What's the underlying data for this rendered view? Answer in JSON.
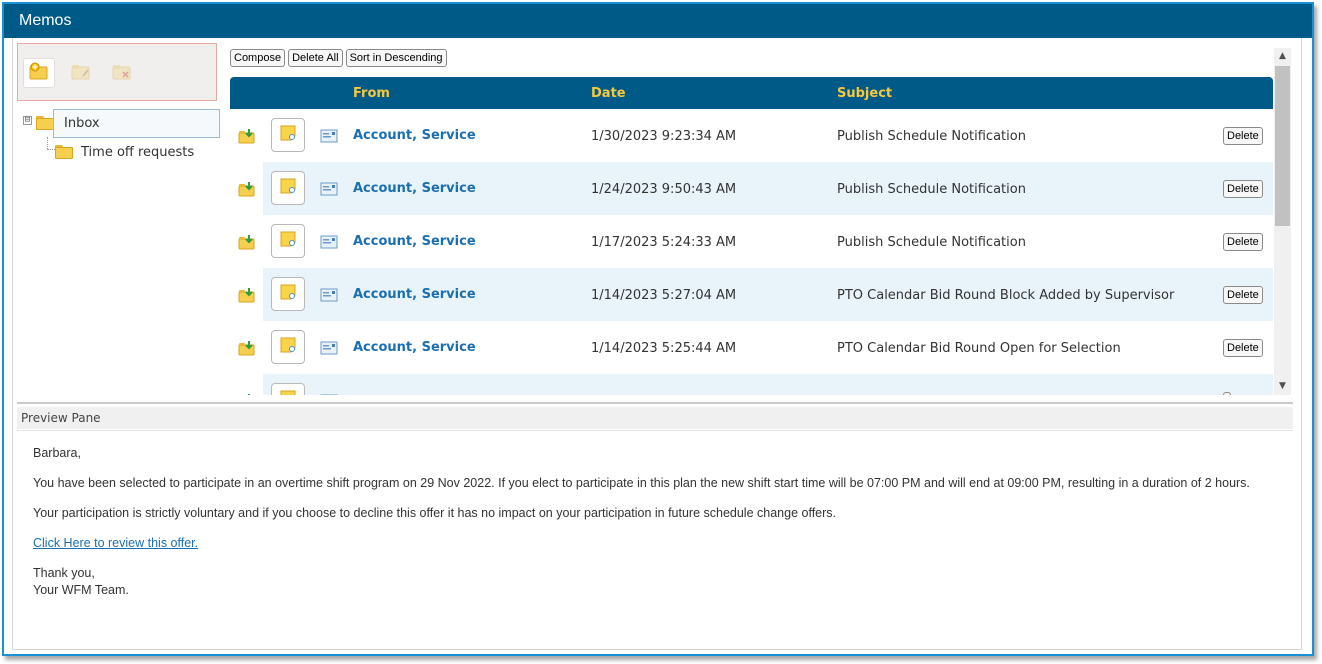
{
  "window": {
    "title": "Memos"
  },
  "folder_toolbar": {
    "buttons": [
      {
        "icon": "new-folder-icon",
        "state": "active"
      },
      {
        "icon": "edit-folder-icon",
        "state": "disabled"
      },
      {
        "icon": "delete-folder-icon",
        "state": "disabled"
      }
    ]
  },
  "tree": {
    "expander": "⊟",
    "inbox": "Inbox",
    "children": [
      "Time off requests"
    ]
  },
  "actions": {
    "compose": "Compose",
    "delete_all": "Delete All",
    "sort": "Sort in Descending"
  },
  "grid": {
    "columns": {
      "from": "From",
      "date": "Date",
      "subject": "Subject"
    },
    "delete_label": "Delete",
    "rows": [
      {
        "from": "Account, Service",
        "date": "1/30/2023 9:23:34 AM",
        "subject": "Publish Schedule Notification"
      },
      {
        "from": "Account, Service",
        "date": "1/24/2023 9:50:43 AM",
        "subject": "Publish Schedule Notification"
      },
      {
        "from": "Account, Service",
        "date": "1/17/2023 5:24:33 AM",
        "subject": "Publish Schedule Notification"
      },
      {
        "from": "Account, Service",
        "date": "1/14/2023 5:27:04 AM",
        "subject": "PTO Calendar Bid Round Block Added by Supervisor"
      },
      {
        "from": "Account, Service",
        "date": "1/14/2023 5:25:44 AM",
        "subject": "PTO Calendar Bid Round Open for Selection"
      }
    ]
  },
  "preview": {
    "header": "Preview Pane",
    "greeting": "Barbara,",
    "paragraph1": "You have been selected to participate in an overtime shift program on 29 Nov 2022.  If you elect to participate in this plan the new shift start time will be 07:00 PM and will end at 09:00 PM, resulting in a duration of 2  hours.",
    "paragraph2": "Your participation is strictly voluntary and if you choose to decline this offer it has no impact on your participation in future schedule change offers.",
    "link": "Click Here to review this offer.",
    "closing": "Thank you,",
    "signature": "Your WFM Team."
  },
  "colors": {
    "header_bg": "#005a87",
    "header_text": "#f5c842",
    "link": "#1a6fb3",
    "alt_row": "#e9f3fa",
    "frame_border": "#1a8fd3"
  }
}
